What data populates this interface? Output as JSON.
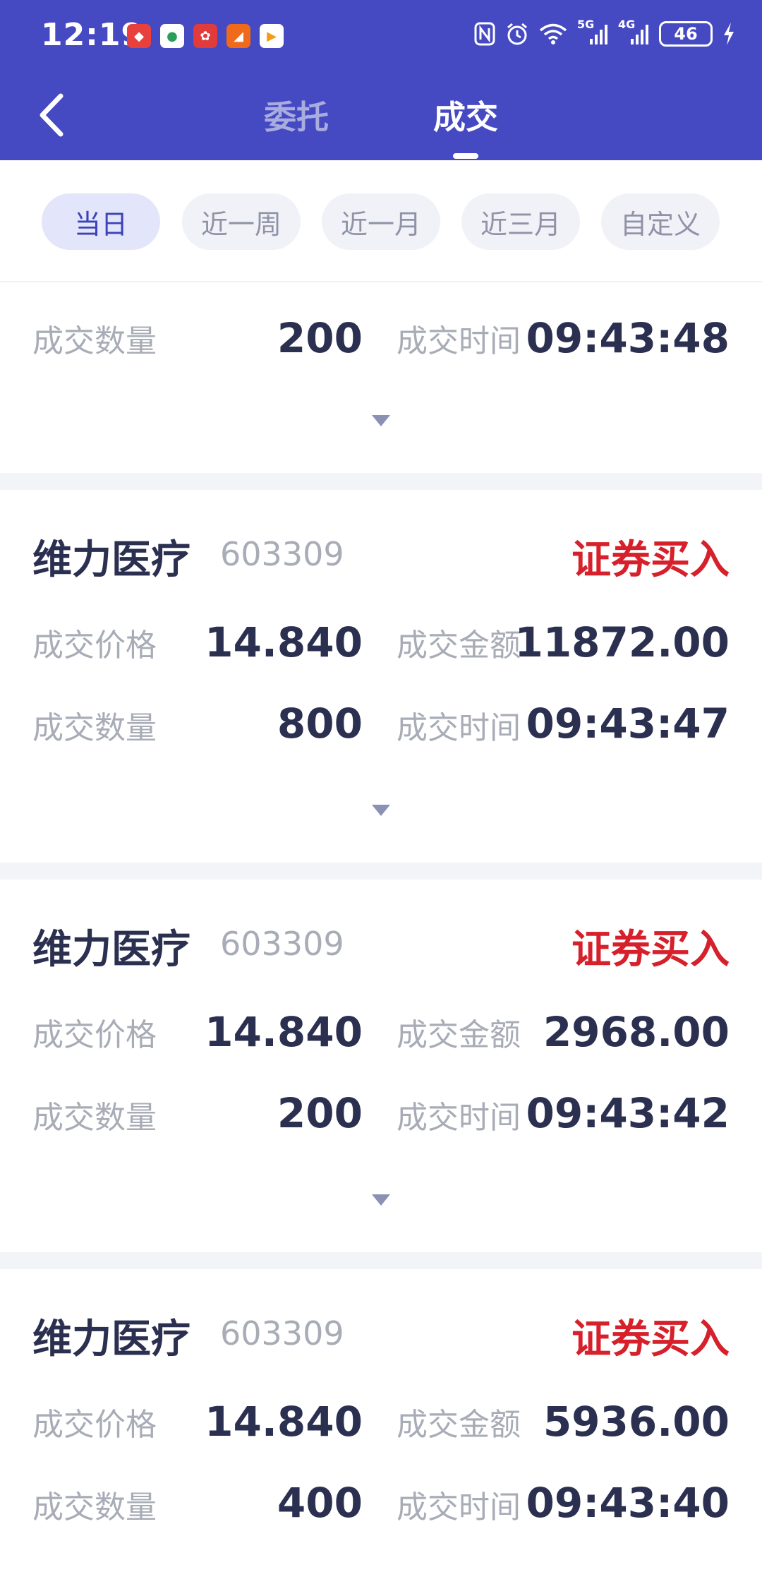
{
  "status_bar": {
    "time": "12:19",
    "battery": "46",
    "network_5g": "5G",
    "network_4g": "4G"
  },
  "nav": {
    "tabs": [
      "委托",
      "成交"
    ],
    "active_tab": "成交"
  },
  "filters": {
    "options": [
      "当日",
      "近一周",
      "近一月",
      "近三月",
      "自定义"
    ],
    "selected": "当日"
  },
  "labels": {
    "price": "成交价格",
    "amount": "成交金额",
    "quantity": "成交数量",
    "time": "成交时间"
  },
  "partial_record": {
    "quantity": "200",
    "time": "09:43:48"
  },
  "records": [
    {
      "name": "维力医疗",
      "code": "603309",
      "type": "证券买入",
      "price": "14.840",
      "amount": "11872.00",
      "quantity": "800",
      "time": "09:43:47"
    },
    {
      "name": "维力医疗",
      "code": "603309",
      "type": "证券买入",
      "price": "14.840",
      "amount": "2968.00",
      "quantity": "200",
      "time": "09:43:42"
    },
    {
      "name": "维力医疗",
      "code": "603309",
      "type": "证券买入",
      "price": "14.840",
      "amount": "5936.00",
      "quantity": "400",
      "time": "09:43:40"
    }
  ],
  "colors": {
    "header": "#4549c2",
    "buy": "#d6202b",
    "text_dark": "#2b3050",
    "text_muted": "#a8acb6"
  }
}
